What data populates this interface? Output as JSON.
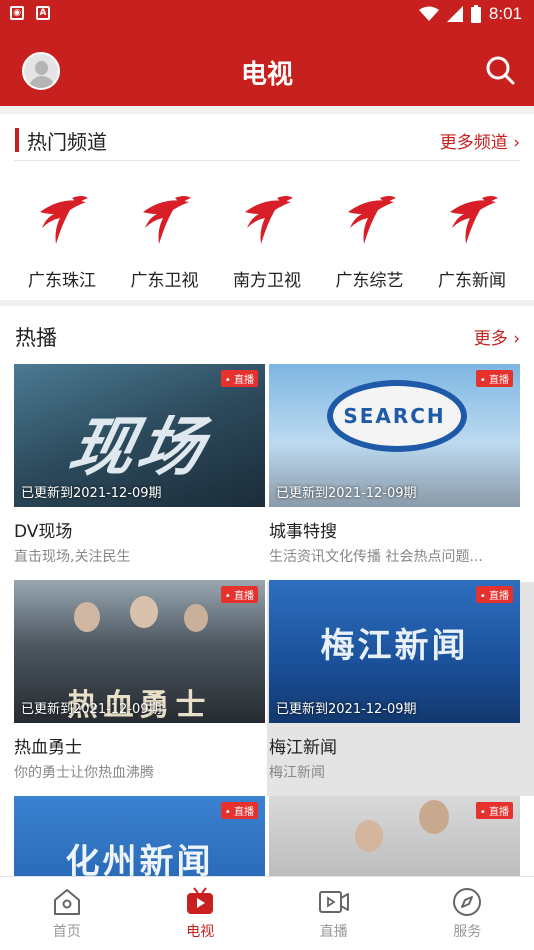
{
  "status_bar": {
    "time": "8:01",
    "left_icons": [
      "notification-icon",
      "app-icon"
    ],
    "right_icons": [
      "wifi-icon",
      "signal-icon",
      "battery-icon"
    ]
  },
  "header": {
    "title": "电视"
  },
  "channels_section": {
    "title": "热门频道",
    "more_label": "更多频道 ›",
    "channels": [
      {
        "name": "广东珠江"
      },
      {
        "name": "广东卫视"
      },
      {
        "name": "南方卫视"
      },
      {
        "name": "广东综艺"
      },
      {
        "name": "广东新闻"
      }
    ]
  },
  "hot_section": {
    "title": "热播",
    "more_label": "更多 ›",
    "live_label": "• 直播",
    "cards": [
      {
        "title": "DV现场",
        "subtitle": "直击现场,关注民生",
        "update": "已更新到2021-12-09期",
        "thumb_text": "现场"
      },
      {
        "title": "城事特搜",
        "subtitle": "生活资讯文化传播 社会热点问题...",
        "update": "已更新到2021-12-09期",
        "thumb_text": "SEARCH"
      },
      {
        "title": "热血勇士",
        "subtitle": "你的勇士让你热血沸腾",
        "update": "已更新到2021-12-09期",
        "thumb_text": "热血勇士"
      },
      {
        "title": "梅江新闻",
        "subtitle": "梅江新闻",
        "update": "已更新到2021-12-09期",
        "thumb_text": "梅江新闻"
      },
      {
        "thumb_text": "化州新闻"
      },
      {
        "thumb_text": ""
      }
    ]
  },
  "tabbar": {
    "tabs": [
      {
        "label": "首页",
        "icon": "home-icon"
      },
      {
        "label": "电视",
        "icon": "tv-icon",
        "active": true
      },
      {
        "label": "直播",
        "icon": "live-video-icon"
      },
      {
        "label": "服务",
        "icon": "compass-icon"
      }
    ]
  },
  "colors": {
    "brand": "#c8201f",
    "live_badge": "#e5322f"
  }
}
